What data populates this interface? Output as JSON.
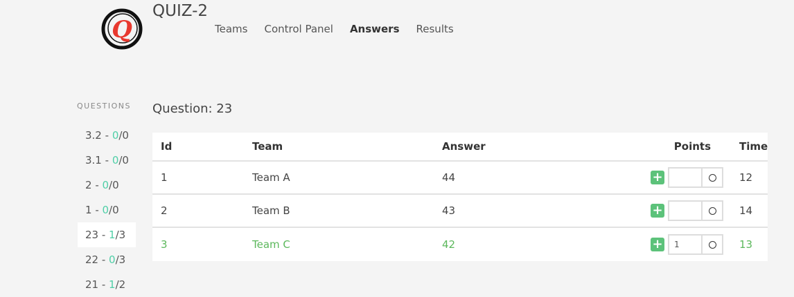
{
  "app": {
    "title": "QUIZ-2",
    "logo_letter": "Q"
  },
  "nav": [
    "Teams",
    "Control Panel",
    "Answers",
    "Results"
  ],
  "sidebar": {
    "label": "QUESTIONS",
    "items": [
      {
        "name": "3.2",
        "correct": "0",
        "total": "0"
      },
      {
        "name": "3.1",
        "correct": "0",
        "total": "0"
      },
      {
        "name": "2",
        "correct": "0",
        "total": "0"
      },
      {
        "name": "1",
        "correct": "0",
        "total": "0"
      },
      {
        "name": "23",
        "correct": "1",
        "total": "3"
      },
      {
        "name": "22",
        "correct": "0",
        "total": "3"
      },
      {
        "name": "21",
        "correct": "1",
        "total": "2"
      }
    ]
  },
  "main": {
    "heading": "Question: 23",
    "columns": [
      "Id",
      "Team",
      "Answer",
      "Points",
      "Time"
    ],
    "rows": [
      {
        "id": "1",
        "team": "Team A",
        "answer": "44",
        "points": "",
        "time": "12"
      },
      {
        "id": "2",
        "team": "Team B",
        "answer": "43",
        "points": "",
        "time": "14"
      },
      {
        "id": "3",
        "team": "Team C",
        "answer": "42",
        "points": "1",
        "time": "13"
      }
    ]
  }
}
